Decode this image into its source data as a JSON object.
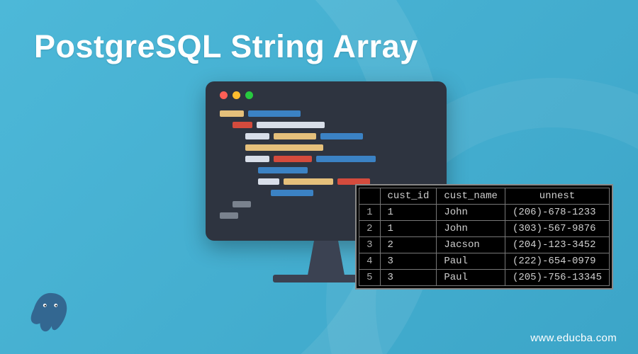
{
  "title": "PostgreSQL String Array",
  "site_url": "www.educba.com",
  "chart_data": {
    "type": "table",
    "title": "Query result",
    "columns": [
      "cust_id",
      "cust_name",
      "unnest"
    ],
    "rows": [
      {
        "n": "1",
        "cust_id": "1",
        "cust_name": "John",
        "unnest": "(206)-678-1233"
      },
      {
        "n": "2",
        "cust_id": "1",
        "cust_name": "John",
        "unnest": "(303)-567-9876"
      },
      {
        "n": "3",
        "cust_id": "2",
        "cust_name": "Jacson",
        "unnest": "(204)-123-3452"
      },
      {
        "n": "4",
        "cust_id": "3",
        "cust_name": "Paul",
        "unnest": "(222)-654-0979"
      },
      {
        "n": "5",
        "cust_id": "3",
        "cust_name": "Paul",
        "unnest": "(205)-756-13345"
      }
    ]
  },
  "logo_name": "postgresql-logo"
}
